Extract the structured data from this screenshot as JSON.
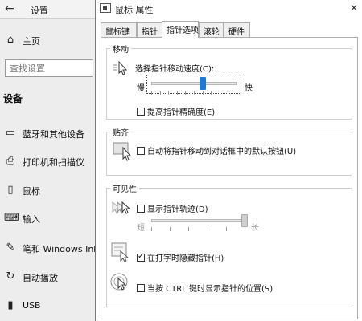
{
  "settings": {
    "title": "设置",
    "home_label": "主页",
    "search_placeholder": "查找设置",
    "section_heading": "设备",
    "nav_items": [
      {
        "label": "蓝牙和其他设备",
        "icon": "bluetooth-devices-icon"
      },
      {
        "label": "打印机和扫描仪",
        "icon": "printer-icon"
      },
      {
        "label": "鼠标",
        "icon": "mouse-icon"
      },
      {
        "label": "输入",
        "icon": "keyboard-icon"
      },
      {
        "label": "笔和 Windows Ink",
        "icon": "pen-icon"
      },
      {
        "label": "自动播放",
        "icon": "autoplay-icon"
      },
      {
        "label": "USB",
        "icon": "usb-icon"
      }
    ]
  },
  "dialog": {
    "title": "鼠标 属性",
    "tabs": [
      "鼠标键",
      "指针",
      "指针选项",
      "滚轮",
      "硬件"
    ],
    "active_tab": "指针选项",
    "motion": {
      "legend": "移动",
      "speed_label": "选择指针移动速度(C):",
      "slow_label": "慢",
      "fast_label": "快",
      "speed_value": 0.6,
      "precision_label": "提高指针精确度(E)",
      "precision_checked": false
    },
    "snap_to": {
      "legend": "贴齐",
      "label": "自动将指针移动到对话框中的默认按钮(U)",
      "checked": false
    },
    "visibility": {
      "legend": "可见性",
      "trails_label": "显示指针轨迹(D)",
      "trails_checked": false,
      "short_label": "短",
      "long_label": "长",
      "trails_value": 1.0,
      "hide_label": "在打字时隐藏指针(H)",
      "hide_checked": true,
      "ctrl_label": "当按 CTRL 键时显示指针的位置(S)",
      "ctrl_checked": false
    }
  },
  "colors": {
    "slider_thumb": "#1c7ad6",
    "border": "#adadad"
  }
}
